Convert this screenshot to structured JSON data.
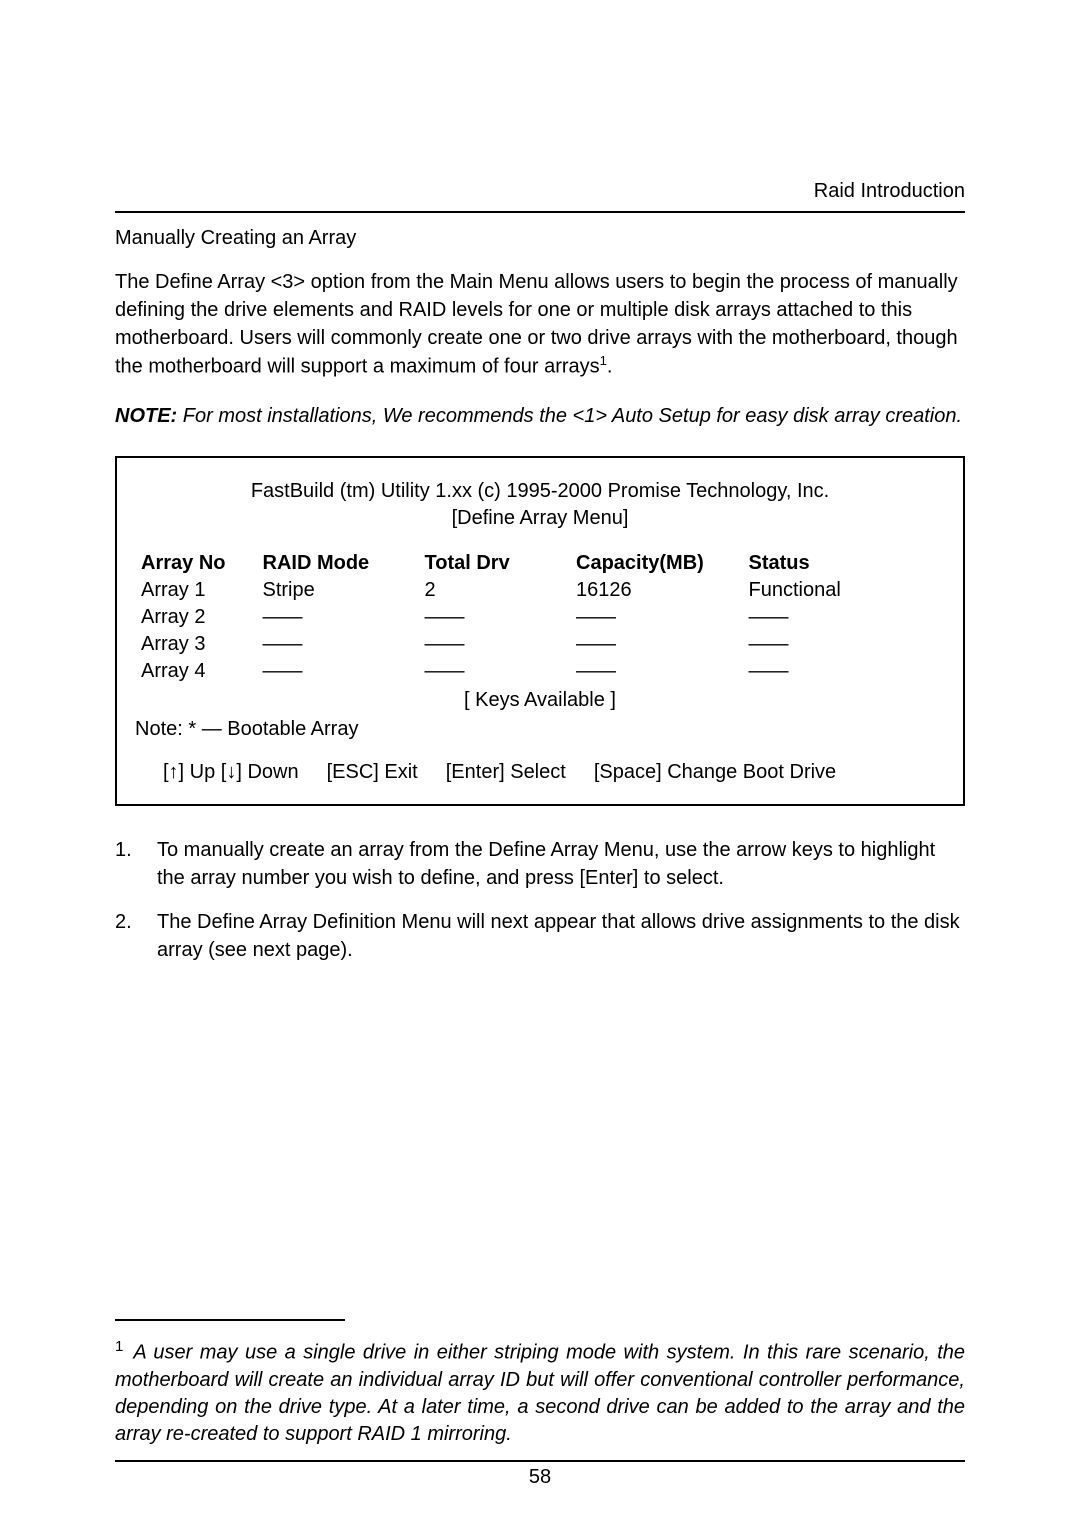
{
  "header": {
    "right": "Raid  Introduction"
  },
  "section_title": "Manually Creating an Array",
  "para1": "The Define Array <3> option from the Main Menu allows users to begin the process of manually defining the drive elements and RAID levels for one or multiple disk arrays attached to this motherboard. Users will commonly create one or two drive arrays with the motherboard, though the motherboard will support a maximum of four arrays",
  "para1_sup": "1",
  "para1_end": ".",
  "note_label": "NOTE:",
  "note_text": " For most installations, We recommends the <1> Auto Setup for easy disk array creation.",
  "menu": {
    "title_line1": "FastBuild (tm) Utility 1.xx (c) 1995-2000 Promise Technology, Inc.",
    "title_line2": "[Define Array Menu]",
    "headers": {
      "array_no": "Array No",
      "raid_mode": "RAID Mode",
      "total_drv": "Total Drv",
      "capacity": "Capacity(MB)",
      "status": "Status"
    },
    "rows": [
      {
        "array_no": "Array 1",
        "raid_mode": "Stripe",
        "total_drv": "2",
        "capacity": "16126",
        "status": "Functional"
      },
      {
        "array_no": "Array 2",
        "raid_mode": "——",
        "total_drv": "——",
        "capacity": "——",
        "status": "——"
      },
      {
        "array_no": "Array 3",
        "raid_mode": "——",
        "total_drv": "——",
        "capacity": "——",
        "status": "——"
      },
      {
        "array_no": "Array 4",
        "raid_mode": "——",
        "total_drv": "——",
        "capacity": "——",
        "status": "——"
      }
    ],
    "keys_label": "[ Keys Available ]",
    "note_boot": "Note: * — Bootable Array",
    "keys": {
      "updown": "[↑] Up [↓] Down",
      "esc": "[ESC] Exit",
      "enter": "[Enter] Select",
      "space": "[Space] Change Boot Drive"
    }
  },
  "list": [
    {
      "num": "1.",
      "text": "To manually create an array from the Define Array Menu, use the arrow keys to highlight the array number you wish to define, and press [Enter] to select."
    },
    {
      "num": "2.",
      "text": "The Define Array Definition Menu will next appear that allows drive assignments to the disk array (see next page)."
    }
  ],
  "footnote": {
    "num": "1",
    "text": "A user may use a single drive in either striping mode with system. In this rare scenario, the motherboard will create an individual array ID but will offer conventional controller performance, depending on the drive type. At a later time, a second drive can be added to the array and the array re-created to support RAID 1 mirroring."
  },
  "page_num": "58"
}
